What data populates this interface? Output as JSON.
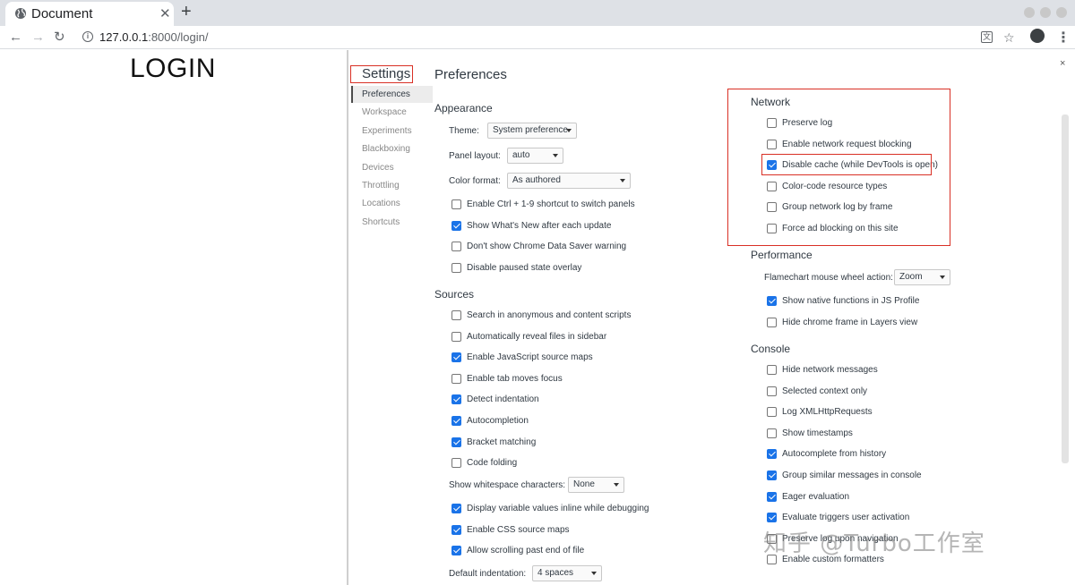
{
  "browser": {
    "tab_title": "Document",
    "url_host": "127.0.0.1",
    "url_rest": ":8000/login/",
    "new_tab_glyph": "+",
    "close_glyph": "✕",
    "back_glyph": "←",
    "forward_glyph": "→",
    "reload_glyph": "↻",
    "translate_glyph": "文",
    "star_glyph": "☆",
    "menu_glyph": "⋮",
    "info_glyph": "i"
  },
  "page": {
    "heading": "LOGIN"
  },
  "devtools": {
    "close_glyph": "×",
    "settings_title": "Settings",
    "preferences_title": "Preferences",
    "sidebar": [
      "Preferences",
      "Workspace",
      "Experiments",
      "Blackboxing",
      "Devices",
      "Throttling",
      "Locations",
      "Shortcuts"
    ],
    "appearance": {
      "title": "Appearance",
      "theme_label": "Theme:",
      "theme_value": "System preference",
      "panel_layout_label": "Panel layout:",
      "panel_layout_value": "auto",
      "color_format_label": "Color format:",
      "color_format_value": "As authored",
      "options": [
        {
          "label": "Enable Ctrl + 1-9 shortcut to switch panels",
          "checked": false
        },
        {
          "label": "Show What's New after each update",
          "checked": true
        },
        {
          "label": "Don't show Chrome Data Saver warning",
          "checked": false
        },
        {
          "label": "Disable paused state overlay",
          "checked": false
        }
      ]
    },
    "sources": {
      "title": "Sources",
      "options": [
        {
          "label": "Search in anonymous and content scripts",
          "checked": false
        },
        {
          "label": "Automatically reveal files in sidebar",
          "checked": false
        },
        {
          "label": "Enable JavaScript source maps",
          "checked": true
        },
        {
          "label": "Enable tab moves focus",
          "checked": false
        },
        {
          "label": "Detect indentation",
          "checked": true
        },
        {
          "label": "Autocompletion",
          "checked": true
        },
        {
          "label": "Bracket matching",
          "checked": true
        },
        {
          "label": "Code folding",
          "checked": false
        }
      ],
      "whitespace_label": "Show whitespace characters:",
      "whitespace_value": "None",
      "options2": [
        {
          "label": "Display variable values inline while debugging",
          "checked": true
        },
        {
          "label": "Enable CSS source maps",
          "checked": true
        },
        {
          "label": "Allow scrolling past end of file",
          "checked": true
        }
      ],
      "indent_label": "Default indentation:",
      "indent_value": "4 spaces"
    },
    "network": {
      "title": "Network",
      "options": [
        {
          "label": "Preserve log",
          "checked": false
        },
        {
          "label": "Enable network request blocking",
          "checked": false
        },
        {
          "label": "Disable cache (while DevTools is open)",
          "checked": true
        },
        {
          "label": "Color-code resource types",
          "checked": false
        },
        {
          "label": "Group network log by frame",
          "checked": false
        },
        {
          "label": "Force ad blocking on this site",
          "checked": false
        }
      ]
    },
    "performance": {
      "title": "Performance",
      "flamechart_label": "Flamechart mouse wheel action:",
      "flamechart_value": "Zoom",
      "options": [
        {
          "label": "Show native functions in JS Profile",
          "checked": true
        },
        {
          "label": "Hide chrome frame in Layers view",
          "checked": false
        }
      ]
    },
    "console": {
      "title": "Console",
      "options": [
        {
          "label": "Hide network messages",
          "checked": false
        },
        {
          "label": "Selected context only",
          "checked": false
        },
        {
          "label": "Log XMLHttpRequests",
          "checked": false
        },
        {
          "label": "Show timestamps",
          "checked": false
        },
        {
          "label": "Autocomplete from history",
          "checked": true
        },
        {
          "label": "Group similar messages in console",
          "checked": true
        },
        {
          "label": "Eager evaluation",
          "checked": true
        },
        {
          "label": "Evaluate triggers user activation",
          "checked": true
        },
        {
          "label": "Preserve log upon navigation",
          "checked": false
        },
        {
          "label": "Enable custom formatters",
          "checked": false
        }
      ]
    }
  },
  "watermark": "知乎 @Turbo工作室",
  "colors": {
    "highlight": "#d93025",
    "checkbox_checked": "#1a73e8",
    "chrome_frame": "#dee1e6"
  }
}
